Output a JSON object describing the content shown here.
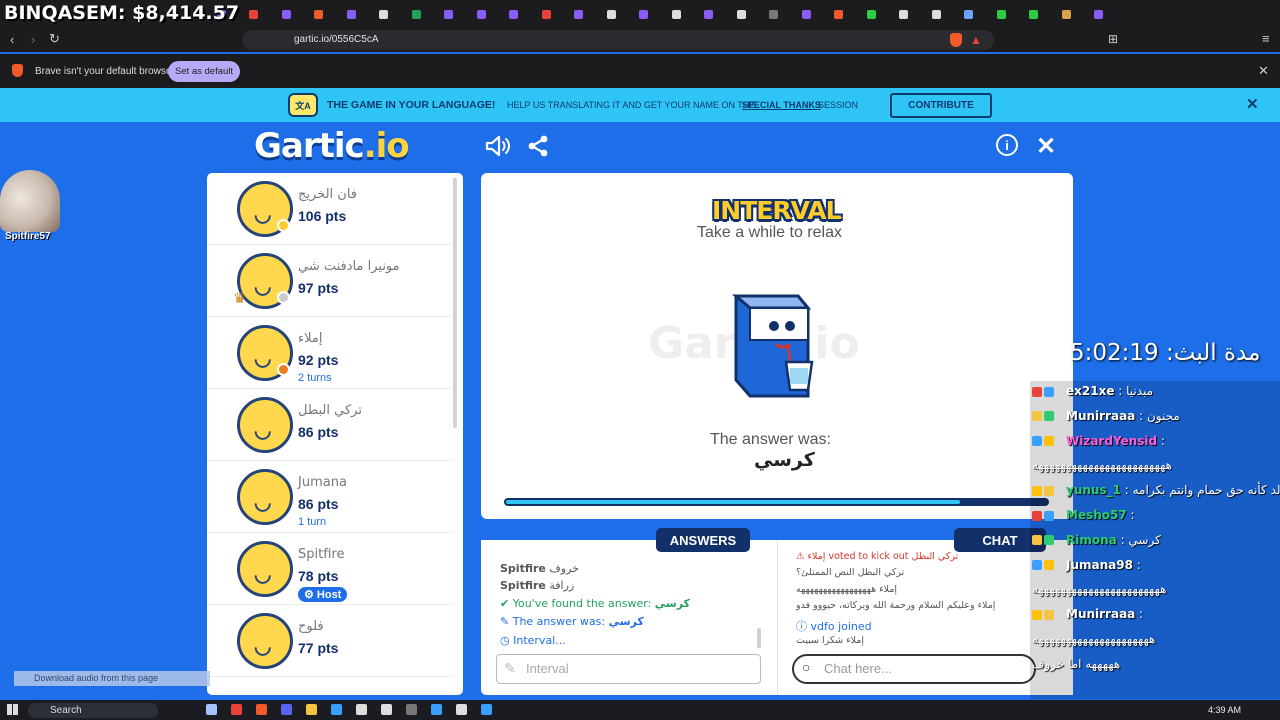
{
  "overlay": {
    "balance": "BINQASEM: $8,414.57"
  },
  "browser": {
    "url": "gartic.io/0556C5cA",
    "notification": "Brave isn't your default browser",
    "set_default_label": "Set as default"
  },
  "banner": {
    "title": "THE GAME IN YOUR LANGUAGE!",
    "text": "HELP US TRANSLATING IT AND GET YOUR NAME ON THE",
    "link": "SPECIAL THANKS",
    "suffix": "SESSION",
    "button": "CONTRIBUTE"
  },
  "game": {
    "logo": "Gartic",
    "logo_io": ".io",
    "cam_user": "Spitfire57",
    "status_title": "INTERVAL",
    "status_subtitle": "Take a while to relax",
    "watermark": "Gartic.io",
    "answer_label": "The answer was:",
    "answer_word": "كرسي",
    "progress": 0.84
  },
  "players": [
    {
      "name": "فان الخريج",
      "pts": "106 pts",
      "turn": "",
      "badge": "#ffcc2e",
      "trophy": false
    },
    {
      "name": "مونيرا مادفنت شي",
      "pts": "97 pts",
      "turn": "",
      "badge": "#cccccc",
      "trophy": true
    },
    {
      "name": "إملاء",
      "pts": "92 pts",
      "turn": "2 turns",
      "badge": "#ee7a1c",
      "trophy": false
    },
    {
      "name": "تركي البطل",
      "pts": "86 pts",
      "turn": "",
      "badge": "",
      "trophy": false
    },
    {
      "name": "Jumana",
      "pts": "86 pts",
      "turn": "1 turn",
      "badge": "",
      "trophy": false
    },
    {
      "name": "Spitfire",
      "pts": "78 pts",
      "turn": "",
      "badge": "",
      "trophy": false,
      "host": "Host"
    },
    {
      "name": "فلوح",
      "pts": "77 pts",
      "turn": "",
      "badge": "",
      "trophy": false
    }
  ],
  "answers": {
    "tab": "ANSWERS",
    "lines": [
      {
        "user": "Spitfire",
        "text": "خروف"
      },
      {
        "user": "Spitfire",
        "text": "زرافة"
      }
    ],
    "found": "You've found the answer:",
    "found_word": "كرسي",
    "was": "The answer was:",
    "was_word": "كرسي",
    "interval": "Interval...",
    "input_placeholder": "Interval"
  },
  "chat": {
    "tab": "CHAT",
    "lines": [
      "⚠ إملاء voted to kick out تركي البطل",
      "تركي البطل النص الممتلئ؟",
      "إملاء هههههههههههههههههه",
      "إملاء وعليكم السلام ورحمة الله وبركاته، حيووو فدو",
      "vdfo joined",
      "إملاء شكرا سبيت"
    ],
    "input_placeholder": "Chat here..."
  },
  "stream": {
    "timer": "مدة البث: 5:02:19",
    "messages": [
      {
        "user": "ex21xe",
        "text": "مبدنيا",
        "color": "#ffffff"
      },
      {
        "user": "Munirraaa",
        "text": "مجنون",
        "color": "#ffffff"
      },
      {
        "user": "WizardYensid",
        "text": "",
        "color": "#ff5cd9"
      },
      {
        "user": "",
        "text": "ههههههههههههههههههههههههه",
        "color": "#ffffff"
      },
      {
        "user": "yunus_1",
        "text": "بولد كأنه حق حمام وانتم بكرامه",
        "color": "#2ecc71"
      },
      {
        "user": "Mesho57",
        "text": "",
        "color": "#2ecc71"
      },
      {
        "user": "Rimona",
        "text": "كرسي",
        "color": "#2ecc71"
      },
      {
        "user": "Jumana98",
        "text": "",
        "color": "#ffffff"
      },
      {
        "user": "",
        "text": "هههههههههههههههههههههههه",
        "color": "#ffffff"
      },
      {
        "user": "Munirraaa",
        "text": "",
        "color": "#ffffff"
      },
      {
        "user": "",
        "text": "هههههههههههههههههههههه",
        "color": "#ffffff"
      },
      {
        "user": "",
        "text": "هههههه اما خروف",
        "color": "#ffffff"
      }
    ],
    "download_audio": "Download audio from this page"
  },
  "taskbar": {
    "search": "Search",
    "clock": "4:39 AM"
  }
}
